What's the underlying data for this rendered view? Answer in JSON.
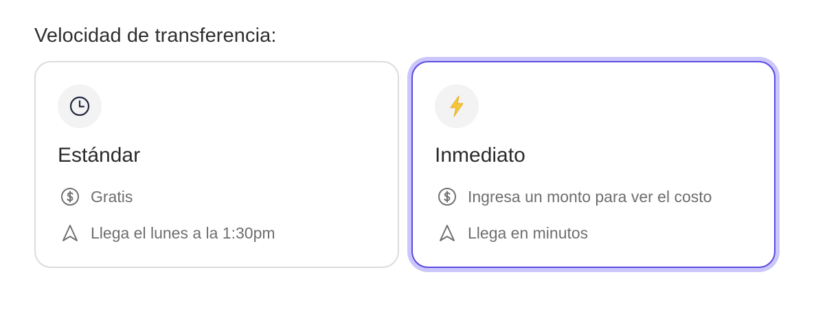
{
  "heading": "Velocidad de transferencia:",
  "options": [
    {
      "title": "Estándar",
      "icon": "clock-icon",
      "selected": false,
      "cost": "Gratis",
      "cost_icon": "dollar-circle-icon",
      "arrival": "Llega el lunes a la 1:30pm",
      "arrival_icon": "navigation-arrow-icon"
    },
    {
      "title": "Inmediato",
      "icon": "lightning-bolt-icon",
      "selected": true,
      "cost": "Ingresa un monto para ver el costo",
      "cost_icon": "dollar-circle-icon",
      "arrival": "Llega en minutos",
      "arrival_icon": "navigation-arrow-icon"
    }
  ],
  "colors": {
    "selected_border": "#5a4be0",
    "selected_glow": "#cbc6fb",
    "bolt": "#f5c83a",
    "muted_text": "#6d6d6d"
  }
}
